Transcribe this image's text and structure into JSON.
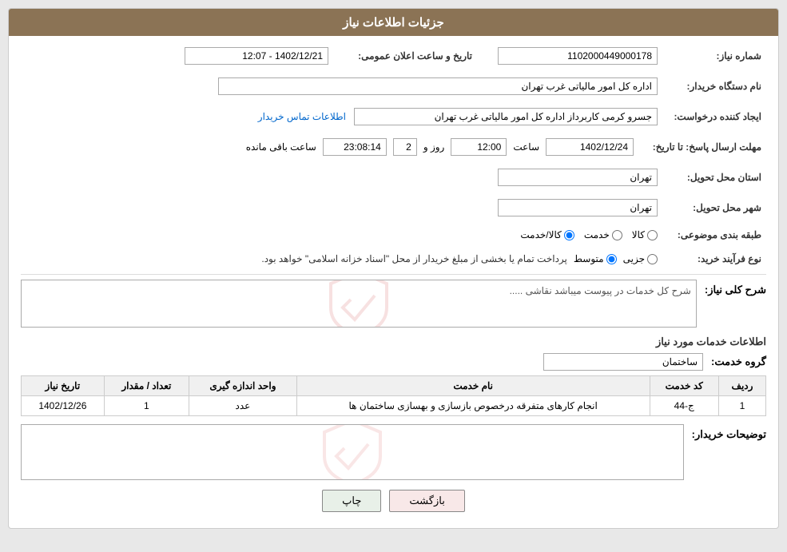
{
  "header": {
    "title": "جزئیات اطلاعات نیاز"
  },
  "fields": {
    "order_number_label": "شماره نیاز:",
    "order_number_value": "1102000449000178",
    "announce_date_label": "تاریخ و ساعت اعلان عمومی:",
    "announce_date_value": "1402/12/21 - 12:07",
    "buyer_org_label": "نام دستگاه خریدار:",
    "buyer_org_value": "اداره کل امور مالیاتی غرب تهران",
    "creator_label": "ایجاد کننده درخواست:",
    "creator_value": "جسرو کرمی کاربرداز اداره کل امور مالیاتی غرب تهران",
    "contact_link": "اطلاعات تماس خریدار",
    "response_deadline_label": "مهلت ارسال پاسخ: تا تاریخ:",
    "response_date": "1402/12/24",
    "response_time_label": "ساعت",
    "response_time": "12:00",
    "remaining_days_label": "روز و",
    "remaining_days": "2",
    "remaining_time": "23:08:14",
    "remaining_suffix": "ساعت باقی مانده",
    "province_label": "استان محل تحویل:",
    "province_value": "تهران",
    "city_label": "شهر محل تحویل:",
    "city_value": "تهران",
    "category_label": "طبقه بندی موضوعی:",
    "category_kala": "کالا",
    "category_khedmat": "خدمت",
    "category_kala_khedmat": "کالا/خدمت",
    "process_label": "نوع فرآیند خرید:",
    "process_jozyi": "جزیی",
    "process_motavasset": "متوسط",
    "process_note": "پرداخت تمام یا بخشی از مبلغ خریدار از محل \"اسناد خزانه اسلامی\" خواهد بود.",
    "overall_description_label": "شرح کلی نیاز:",
    "overall_description_text": "شرح کل خدمات در پیوست میباشد نقاشی .....",
    "services_section_label": "اطلاعات خدمات مورد نیاز",
    "service_group_label": "گروه خدمت:",
    "service_group_value": "ساختمان",
    "table_headers": {
      "row_num": "ردیف",
      "service_code": "کد خدمت",
      "service_name": "نام خدمت",
      "unit": "واحد اندازه گیری",
      "quantity": "تعداد / مقدار",
      "date": "تاریخ نیاز"
    },
    "table_rows": [
      {
        "row_num": "1",
        "service_code": "ج-44",
        "service_name": "انجام کارهای متفرقه درخصوص بازسازی و بهسازی ساختمان ها",
        "unit": "عدد",
        "quantity": "1",
        "date": "1402/12/26"
      }
    ],
    "buyer_desc_label": "توضیحات خریدار:",
    "buttons": {
      "print": "چاپ",
      "back": "بازگشت"
    }
  }
}
